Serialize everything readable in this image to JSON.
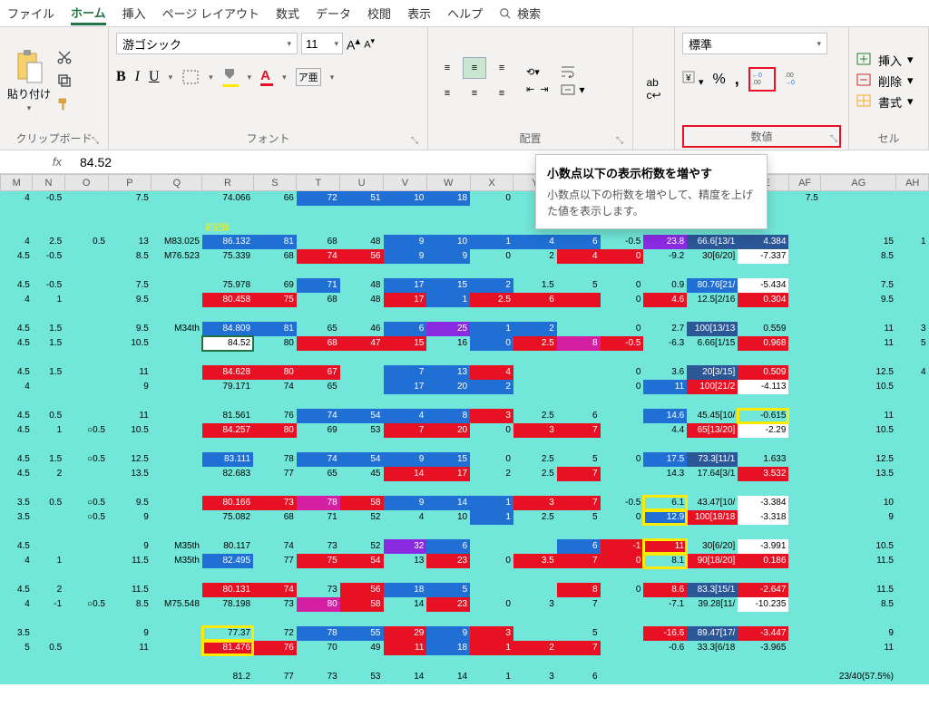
{
  "tabs": [
    "ファイル",
    "ホーム",
    "挿入",
    "ページ レイアウト",
    "数式",
    "データ",
    "校閲",
    "表示",
    "ヘルプ"
  ],
  "active_tab": 1,
  "search_label": "検索",
  "ribbon": {
    "clipboard": {
      "paste": "貼り付け",
      "label": "クリップボード"
    },
    "font": {
      "name": "游ゴシック",
      "size": "11",
      "label": "フォント"
    },
    "align": {
      "label": "配置"
    },
    "number": {
      "format": "標準",
      "label": "数値"
    },
    "cells": {
      "insert": "挿入",
      "delete": "削除",
      "format": "書式",
      "label": "セル"
    }
  },
  "tooltip": {
    "title": "小数点以下の表示桁数を増やす",
    "body": "小数点以下の桁数を増やして、精度を上げた値を表示します。"
  },
  "formula_value": "84.52",
  "columns": [
    "M",
    "N",
    "O",
    "P",
    "Q",
    "R",
    "S",
    "T",
    "U",
    "V",
    "W",
    "X",
    "Y",
    "",
    "",
    "",
    "",
    "AE",
    "AF",
    "AG",
    "AH"
  ],
  "new_record_label": "新記録",
  "rows": [
    {
      "c": [
        "4",
        "-0.5",
        "",
        "7.5",
        "",
        "74.066",
        "66",
        "72",
        "51",
        "10",
        "18",
        "0",
        "",
        "",
        "",
        "",
        "",
        "",
        "7.5",
        "",
        ""
      ],
      "s": {
        "7": "blue",
        "8": "blue",
        "9": "blue",
        "10": "blue"
      }
    },
    {
      "blank": true
    },
    {
      "c": [
        "4",
        "2.5",
        "0.5",
        "13",
        "M83.025",
        "86.132",
        "81",
        "68",
        "48",
        "9",
        "10",
        "1",
        "4",
        "6",
        "-0.5",
        "23.8",
        "66.6[13/1",
        "4.384",
        "",
        "15",
        "1"
      ],
      "s": {
        "5": "blue",
        "6": "blue",
        "9": "blue",
        "10": "blue",
        "11": "blue",
        "12": "blue",
        "13": "blue",
        "15": "purple",
        "16": "dblue",
        "17": "dblue"
      }
    },
    {
      "c": [
        "4.5",
        "-0.5",
        "",
        "8.5",
        "M76.523",
        "75.339",
        "68",
        "74",
        "56",
        "9",
        "9",
        "0",
        "2",
        "4",
        "0",
        "-9.2",
        "30[6/20]",
        "-7.337",
        "",
        "8.5",
        ""
      ],
      "s": {
        "7": "red",
        "8": "red",
        "9": "blue",
        "10": "blue",
        "13": "red",
        "14": "red",
        "17": "w"
      }
    },
    {
      "blank": true
    },
    {
      "c": [
        "4.5",
        "-0.5",
        "",
        "7.5",
        "",
        "75.978",
        "69",
        "71",
        "48",
        "17",
        "15",
        "2",
        "1.5",
        "5",
        "0",
        "0.9",
        "80.76[21/",
        "-5.434",
        "",
        "7.5",
        ""
      ],
      "s": {
        "7": "blue",
        "9": "blue",
        "10": "blue",
        "11": "blue",
        "16": "blue",
        "17": "w"
      }
    },
    {
      "c": [
        "4",
        "1",
        "",
        "9.5",
        "",
        "80.458",
        "75",
        "68",
        "48",
        "17",
        "1",
        "2.5",
        "6",
        "",
        "0",
        "4.6",
        "12.5[2/16",
        "0.304",
        "",
        "9.5",
        ""
      ],
      "s": {
        "5": "red",
        "6": "red",
        "9": "red",
        "10": "blue",
        "11": "red",
        "12": "red",
        "13": "red",
        "15": "red",
        "17": "red"
      }
    },
    {
      "blank": true
    },
    {
      "c": [
        "4.5",
        "1.5",
        "",
        "9.5",
        "M34th",
        "84.809",
        "81",
        "65",
        "46",
        "6",
        "25",
        "1",
        "2",
        "",
        "0",
        "2.7",
        "100[13/13",
        "0.559",
        "",
        "11",
        "3"
      ],
      "s": {
        "5": "blue",
        "6": "blue",
        "9": "blue",
        "10": "purple",
        "11": "blue",
        "12": "blue",
        "16": "dblue"
      }
    },
    {
      "c": [
        "4.5",
        "1.5",
        "",
        "10.5",
        "",
        "84.52",
        "80",
        "68",
        "47",
        "15",
        "16",
        "0",
        "2.5",
        "8",
        "-0.5",
        "-6.3",
        "6.66[1/15",
        "0.968",
        "",
        "11",
        "5"
      ],
      "s": {
        "5": "sel",
        "7": "red",
        "8": "red",
        "9": "red",
        "11": "blue",
        "12": "red",
        "13": "mag",
        "14": "red",
        "17": "red"
      }
    },
    {
      "blank": true
    },
    {
      "c": [
        "4.5",
        "1.5",
        "",
        "11",
        "",
        "84.628",
        "80",
        "67",
        "",
        "7",
        "13",
        "4",
        "",
        "",
        "0",
        "3.6",
        "20[3/15]",
        "0.509",
        "",
        "12.5",
        "4"
      ],
      "s": {
        "5": "red",
        "6": "red",
        "7": "red",
        "9": "blue",
        "10": "blue",
        "11": "red",
        "16": "dblue",
        "17": "red"
      }
    },
    {
      "c": [
        "4",
        "",
        "",
        "9",
        "",
        "79.171",
        "74",
        "65",
        "",
        "17",
        "20",
        "2",
        "",
        "",
        "0",
        "11",
        "100[21/2",
        "-4.113",
        "",
        "10.5",
        ""
      ],
      "s": {
        "9": "blue",
        "10": "blue",
        "11": "blue",
        "15": "blue",
        "16": "red",
        "17": "w"
      }
    },
    {
      "blank": true
    },
    {
      "c": [
        "4.5",
        "0.5",
        "",
        "11",
        "",
        "81.561",
        "76",
        "74",
        "54",
        "4",
        "8",
        "3",
        "2.5",
        "6",
        "",
        "14.6",
        "45.45[10/",
        "-0.615",
        "",
        "11",
        ""
      ],
      "s": {
        "7": "blue",
        "8": "blue",
        "9": "blue",
        "10": "blue",
        "11": "red",
        "15": "blue",
        "17": "ybor"
      }
    },
    {
      "c": [
        "4.5",
        "1",
        "○0.5",
        "10.5",
        "",
        "84.257",
        "80",
        "69",
        "53",
        "7",
        "20",
        "0",
        "3",
        "7",
        "",
        "4.4",
        "65[13/20]",
        "-2.29",
        "",
        "10.5",
        ""
      ],
      "s": {
        "5": "red",
        "6": "red",
        "9": "red",
        "10": "red",
        "12": "red",
        "13": "red",
        "16": "red",
        "17": "w"
      }
    },
    {
      "blank": true
    },
    {
      "c": [
        "4.5",
        "1.5",
        "○0.5",
        "12.5",
        "",
        "83.111",
        "78",
        "74",
        "54",
        "9",
        "15",
        "0",
        "2.5",
        "5",
        "0",
        "17.5",
        "73.3[11/1",
        "1.633",
        "",
        "12.5",
        ""
      ],
      "s": {
        "5": "blue",
        "7": "blue",
        "8": "blue",
        "9": "blue",
        "10": "blue",
        "15": "blue",
        "16": "dblue"
      }
    },
    {
      "c": [
        "4.5",
        "2",
        "",
        "13.5",
        "",
        "82.683",
        "77",
        "65",
        "45",
        "14",
        "17",
        "2",
        "2.5",
        "7",
        "",
        "14.3",
        "17.64[3/1",
        "3.532",
        "",
        "13.5",
        ""
      ],
      "s": {
        "9": "red",
        "10": "red",
        "13": "red",
        "17": "red"
      }
    },
    {
      "blank": true
    },
    {
      "c": [
        "3.5",
        "0.5",
        "○0.5",
        "9.5",
        "",
        "80.166",
        "73",
        "78",
        "58",
        "9",
        "14",
        "1",
        "3",
        "7",
        "-0.5",
        "6.1",
        "43.47[10/",
        "-3.384",
        "",
        "10",
        ""
      ],
      "s": {
        "5": "red",
        "6": "red",
        "7": "mag",
        "8": "red",
        "9": "blue",
        "10": "blue",
        "11": "blue",
        "12": "red",
        "13": "red",
        "15": "ybor",
        "17": "w"
      }
    },
    {
      "c": [
        "3.5",
        "",
        "○0.5",
        "9",
        "",
        "75.082",
        "68",
        "71",
        "52",
        "4",
        "10",
        "1",
        "2.5",
        "5",
        "0",
        "12.9",
        "100[18/18",
        "-3.318",
        "",
        "9",
        ""
      ],
      "s": {
        "11": "blue",
        "15": "blue ybor",
        "16": "red",
        "17": "w"
      }
    },
    {
      "blank": true
    },
    {
      "c": [
        "4.5",
        "",
        "",
        "9",
        "M35th",
        "80.117",
        "74",
        "73",
        "52",
        "32",
        "6",
        "",
        "",
        "6",
        "-1",
        "11",
        "30[6/20]",
        "-3.991",
        "",
        "10.5",
        ""
      ],
      "s": {
        "9": "purple",
        "10": "blue",
        "13": "blue",
        "14": "red",
        "15": "red ybor",
        "17": "w"
      }
    },
    {
      "c": [
        "4",
        "1",
        "",
        "11.5",
        "M35th",
        "82.495",
        "77",
        "75",
        "54",
        "13",
        "23",
        "0",
        "3.5",
        "7",
        "0",
        "8.1",
        "90[18/20]",
        "0.186",
        "",
        "11.5",
        ""
      ],
      "s": {
        "5": "blue",
        "7": "red",
        "8": "red",
        "10": "red",
        "12": "red",
        "13": "red",
        "14": "red",
        "15": "ybor",
        "16": "red",
        "17": "red"
      }
    },
    {
      "blank": true
    },
    {
      "c": [
        "4.5",
        "2",
        "",
        "11.5",
        "",
        "80.131",
        "74",
        "73",
        "56",
        "18",
        "5",
        "",
        "",
        "8",
        "0",
        "8.6",
        "83.3[15/1",
        "-2.647",
        "",
        "11.5",
        ""
      ],
      "s": {
        "5": "red",
        "6": "red",
        "8": "red",
        "9": "blue",
        "10": "blue",
        "13": "red",
        "15": "red",
        "16": "dblue",
        "17": "red"
      }
    },
    {
      "c": [
        "4",
        "-1",
        "○0.5",
        "8.5",
        "M75.548",
        "78.198",
        "73",
        "80",
        "58",
        "14",
        "23",
        "0",
        "3",
        "7",
        "",
        "-7.1",
        "39.28[11/",
        "-10.235",
        "",
        "8.5",
        ""
      ],
      "s": {
        "7": "mag",
        "8": "red",
        "10": "red",
        "17": "w"
      }
    },
    {
      "blank": true
    },
    {
      "c": [
        "3.5",
        "",
        "",
        "9",
        "",
        "77.37",
        "72",
        "78",
        "55",
        "29",
        "9",
        "3",
        "",
        "5",
        "",
        "-16.6",
        "89.47[17/",
        "-3.447",
        "",
        "9",
        ""
      ],
      "s": {
        "5": "ybor",
        "7": "blue",
        "8": "blue",
        "9": "red",
        "10": "blue",
        "11": "red",
        "15": "red",
        "16": "dblue",
        "17": "red"
      }
    },
    {
      "c": [
        "5",
        "0.5",
        "",
        "11",
        "",
        "81.476",
        "76",
        "70",
        "49",
        "11",
        "18",
        "1",
        "2",
        "7",
        "",
        "-0.6",
        "33.3[6/18",
        "-3.965",
        "",
        "11",
        ""
      ],
      "s": {
        "5": "red ybor",
        "6": "red",
        "9": "red",
        "10": "blue",
        "11": "red",
        "12": "red",
        "13": "red"
      }
    },
    {
      "blank": true
    },
    {
      "c": [
        "",
        "",
        "",
        "",
        "",
        "81.2",
        "77",
        "73",
        "53",
        "14",
        "14",
        "1",
        "3",
        "6",
        "",
        "",
        "",
        "",
        "",
        "23/40(57.5%)",
        ""
      ],
      "s": {}
    }
  ]
}
